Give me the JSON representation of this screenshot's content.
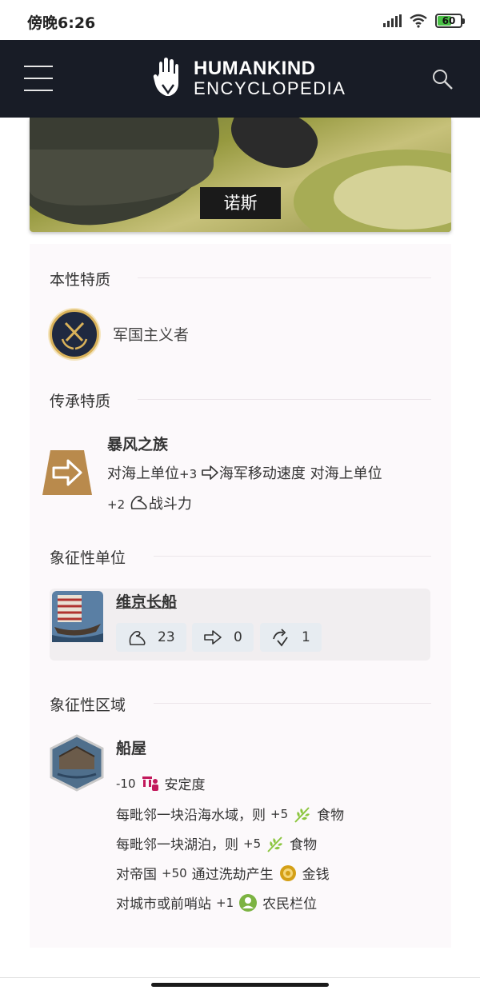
{
  "status_bar": {
    "time": "傍晚6:26",
    "battery": "60"
  },
  "header": {
    "brand_line1": "HUMANKIND",
    "brand_line2": "ENCYCLOPEDIA"
  },
  "hero": {
    "title": "诺斯"
  },
  "sections": {
    "inherent_trait": {
      "title": "本性特质",
      "label": "军国主义者",
      "icon": "crossed-swords-laurel-icon"
    },
    "legacy_trait": {
      "title": "传承特质",
      "name": "暴风之族",
      "line1_prefix": "对海上单位",
      "line1_num": "+3",
      "line1_stat": "海军移动速度 对海上单位",
      "line2_num": "+2",
      "line2_stat": "战斗力",
      "icon": "arrow-right-badge-icon"
    },
    "emblematic_unit": {
      "title": "象征性单位",
      "name": "维京长船",
      "stats": [
        {
          "icon": "strength-icon",
          "value": "23"
        },
        {
          "icon": "movement-icon",
          "value": "0"
        },
        {
          "icon": "range-icon",
          "value": "1"
        }
      ]
    },
    "emblematic_district": {
      "title": "象征性区域",
      "name": "船屋",
      "effects": [
        {
          "num": "-10",
          "text_before": "",
          "icon": "stability-icon",
          "label": "安定度"
        },
        {
          "num": "+5",
          "text_before": "每毗邻一块沿海水域，则",
          "icon": "food-icon",
          "label": "食物"
        },
        {
          "num": "+5",
          "text_before": "每毗邻一块湖泊，则",
          "icon": "food-icon",
          "label": "食物"
        },
        {
          "num": "+50",
          "text_before": "对帝国",
          "icon": "money-icon",
          "label": "通过洗劫产生",
          "label2": "金钱"
        },
        {
          "num": "+1",
          "text_before": "对城市或前哨站",
          "icon": "farmer-slot-icon",
          "label": "农民栏位"
        }
      ]
    }
  },
  "colors": {
    "header_bg": "#181c26",
    "card_bg": "#fcf9fb",
    "gold": "#d9b25a",
    "food_green": "#8cc63f",
    "stability_pink": "#c2185b",
    "money_gold": "#d4a017",
    "farmer_green": "#7cb342"
  }
}
